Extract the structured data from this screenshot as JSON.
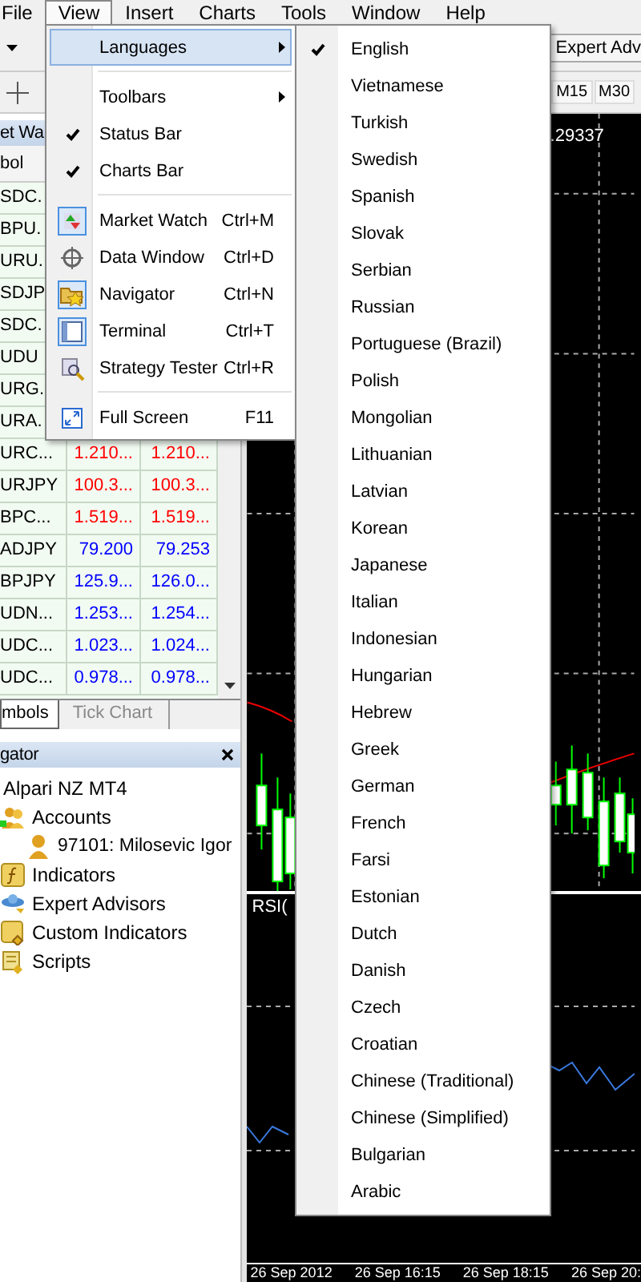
{
  "menubar": {
    "items": [
      {
        "label": "File",
        "open": false
      },
      {
        "label": "View",
        "open": true
      },
      {
        "label": "Insert",
        "open": false
      },
      {
        "label": "Charts",
        "open": false
      },
      {
        "label": "Tools",
        "open": false
      },
      {
        "label": "Window",
        "open": false
      },
      {
        "label": "Help",
        "open": false
      }
    ]
  },
  "toolbar": {
    "button": "Expert Adv",
    "timeframes": [
      "M15",
      "M30"
    ]
  },
  "market_watch": {
    "title": "et Wa",
    "column": "bol",
    "rows": [
      {
        "symbol": "SDC."
      },
      {
        "symbol": "BPU."
      },
      {
        "symbol": "URU."
      },
      {
        "symbol": "SDJP"
      },
      {
        "symbol": "SDC."
      },
      {
        "symbol": "UDU"
      },
      {
        "symbol": "URG."
      },
      {
        "symbol": "URA."
      },
      {
        "symbol": "URC...",
        "bid": "1.210...",
        "ask": "1.210...",
        "color": "#ff0000"
      },
      {
        "symbol": "URJPY",
        "bid": "100.3...",
        "ask": "100.3...",
        "color": "#ff0000"
      },
      {
        "symbol": "BPC...",
        "bid": "1.519...",
        "ask": "1.519...",
        "color": "#ff0000"
      },
      {
        "symbol": "ADJPY",
        "bid": "79.200",
        "ask": "79.253",
        "color": "#0000ff"
      },
      {
        "symbol": "BPJPY",
        "bid": "125.9...",
        "ask": "126.0...",
        "color": "#0000ff"
      },
      {
        "symbol": "UDN...",
        "bid": "1.253...",
        "ask": "1.254...",
        "color": "#0000ff"
      },
      {
        "symbol": "UDC...",
        "bid": "1.023...",
        "ask": "1.024...",
        "color": "#0000ff"
      },
      {
        "symbol": "UDC...",
        "bid": "0.978...",
        "ask": "0.978...",
        "color": "#0000ff"
      }
    ],
    "tabs": [
      {
        "label": "mbols",
        "selected": true
      },
      {
        "label": "Tick Chart",
        "selected": false
      }
    ]
  },
  "navigator": {
    "title": "gator",
    "tree": [
      {
        "label": "Alpari NZ MT4",
        "children": [
          {
            "label": "Accounts",
            "children": [
              {
                "label": "97101: Milosevic Igor"
              }
            ]
          },
          {
            "label": "Indicators"
          },
          {
            "label": "Expert Advisors"
          },
          {
            "label": "Custom Indicators"
          },
          {
            "label": "Scripts"
          }
        ]
      }
    ]
  },
  "chart": {
    "price_label": ".29337",
    "subwindow_label": "RSI(",
    "time_labels": [
      "26 Sep 2012",
      "26 Sep 16:15",
      "26 Sep 18:15",
      "26 Sep 20:"
    ]
  },
  "view_menu": {
    "groups": [
      [
        {
          "label": "Languages",
          "kind": "submenu",
          "selected": true
        }
      ],
      [
        {
          "label": "Toolbars",
          "kind": "submenu",
          "selected": false
        },
        {
          "label": "Status Bar",
          "kind": "check",
          "checked": true,
          "selected": false
        },
        {
          "label": "Charts Bar",
          "kind": "check",
          "checked": true,
          "selected": false
        }
      ],
      [
        {
          "label": "Market Watch",
          "kind": "icon",
          "shortcut": "Ctrl+M",
          "checked": true,
          "selected": false
        },
        {
          "label": "Data Window",
          "kind": "icon",
          "shortcut": "Ctrl+D",
          "checked": false,
          "selected": false
        },
        {
          "label": "Navigator",
          "kind": "icon",
          "shortcut": "Ctrl+N",
          "checked": true,
          "selected": false
        },
        {
          "label": "Terminal",
          "kind": "icon",
          "shortcut": "Ctrl+T",
          "checked": true,
          "selected": false
        },
        {
          "label": "Strategy Tester",
          "kind": "icon",
          "shortcut": "Ctrl+R",
          "checked": false,
          "selected": false
        }
      ],
      [
        {
          "label": "Full Screen",
          "kind": "icon",
          "shortcut": "F11",
          "checked": false,
          "selected": false
        }
      ]
    ]
  },
  "languages_menu": {
    "items": [
      {
        "label": "English",
        "checked": true
      },
      {
        "label": "Vietnamese",
        "checked": false
      },
      {
        "label": "Turkish",
        "checked": false
      },
      {
        "label": "Swedish",
        "checked": false
      },
      {
        "label": "Spanish",
        "checked": false
      },
      {
        "label": "Slovak",
        "checked": false
      },
      {
        "label": "Serbian",
        "checked": false
      },
      {
        "label": "Russian",
        "checked": false
      },
      {
        "label": "Portuguese (Brazil)",
        "checked": false
      },
      {
        "label": "Polish",
        "checked": false
      },
      {
        "label": "Mongolian",
        "checked": false
      },
      {
        "label": "Lithuanian",
        "checked": false
      },
      {
        "label": "Latvian",
        "checked": false
      },
      {
        "label": "Korean",
        "checked": false
      },
      {
        "label": "Japanese",
        "checked": false
      },
      {
        "label": "Italian",
        "checked": false
      },
      {
        "label": "Indonesian",
        "checked": false
      },
      {
        "label": "Hungarian",
        "checked": false
      },
      {
        "label": "Hebrew",
        "checked": false
      },
      {
        "label": "Greek",
        "checked": false
      },
      {
        "label": "German",
        "checked": false
      },
      {
        "label": "French",
        "checked": false
      },
      {
        "label": "Farsi",
        "checked": false
      },
      {
        "label": "Estonian",
        "checked": false
      },
      {
        "label": "Dutch",
        "checked": false
      },
      {
        "label": "Danish",
        "checked": false
      },
      {
        "label": "Czech",
        "checked": false
      },
      {
        "label": "Croatian",
        "checked": false
      },
      {
        "label": "Chinese (Traditional)",
        "checked": false
      },
      {
        "label": "Chinese (Simplified)",
        "checked": false
      },
      {
        "label": "Bulgarian",
        "checked": false
      },
      {
        "label": "Arabic",
        "checked": false
      }
    ]
  }
}
